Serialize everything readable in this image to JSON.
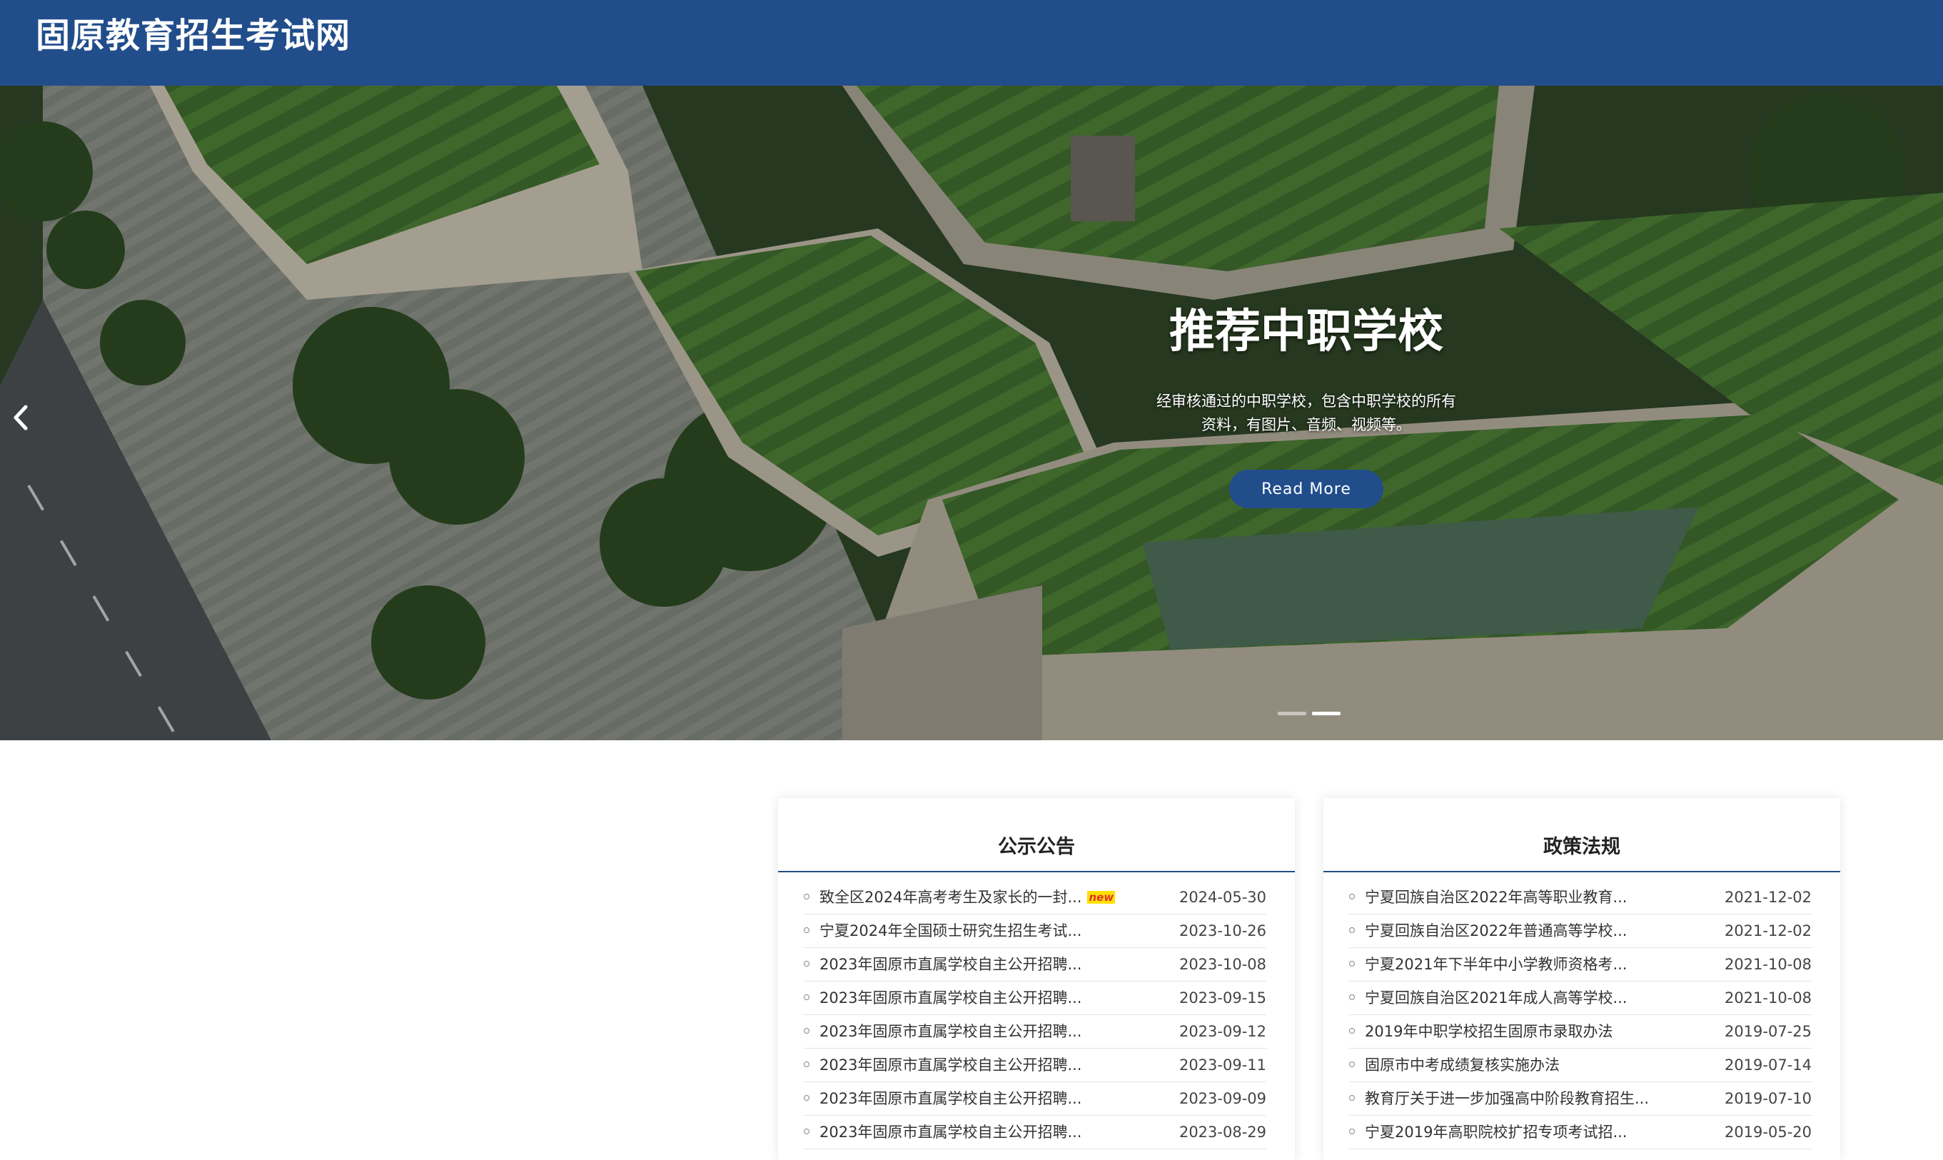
{
  "header": {
    "site_title": "固原教育招生考试网"
  },
  "hero": {
    "heading": "推荐中职学校",
    "description": "经审核通过的中职学校，包含中职学校的所有资料，有图片、音频、视频等。",
    "button_label": "Read More",
    "prev_icon": "chevron-left-icon",
    "slide_count": 2,
    "active_slide": 2
  },
  "notices": {
    "title": "公示公告",
    "items": [
      {
        "title": "致全区2024年高考考生及家长的一封...",
        "badge": "new",
        "date": "2024-05-30"
      },
      {
        "title": "宁夏2024年全国硕士研究生招生考试...",
        "badge": "",
        "date": "2023-10-26"
      },
      {
        "title": "2023年固原市直属学校自主公开招聘...",
        "badge": "",
        "date": "2023-10-08"
      },
      {
        "title": "2023年固原市直属学校自主公开招聘...",
        "badge": "",
        "date": "2023-09-15"
      },
      {
        "title": "2023年固原市直属学校自主公开招聘...",
        "badge": "",
        "date": "2023-09-12"
      },
      {
        "title": "2023年固原市直属学校自主公开招聘...",
        "badge": "",
        "date": "2023-09-11"
      },
      {
        "title": "2023年固原市直属学校自主公开招聘...",
        "badge": "",
        "date": "2023-09-09"
      },
      {
        "title": "2023年固原市直属学校自主公开招聘...",
        "badge": "",
        "date": "2023-08-29"
      }
    ]
  },
  "policies": {
    "title": "政策法规",
    "items": [
      {
        "title": "宁夏回族自治区2022年高等职业教育...",
        "date": "2021-12-02"
      },
      {
        "title": "宁夏回族自治区2022年普通高等学校...",
        "date": "2021-12-02"
      },
      {
        "title": "宁夏2021年下半年中小学教师资格考...",
        "date": "2021-10-08"
      },
      {
        "title": "宁夏回族自治区2021年成人高等学校...",
        "date": "2021-10-08"
      },
      {
        "title": "2019年中职学校招生固原市录取办法",
        "date": "2019-07-25"
      },
      {
        "title": "固原市中考成绩复核实施办法",
        "date": "2019-07-14"
      },
      {
        "title": "教育厅关于进一步加强高中阶段教育招生...",
        "date": "2019-07-10"
      },
      {
        "title": "宁夏2019年高职院校扩招专项考试招...",
        "date": "2019-05-20"
      }
    ]
  },
  "colors": {
    "brand_blue": "#214d8b",
    "badge_red": "#e0312a",
    "badge_yellow": "#ffe100"
  }
}
